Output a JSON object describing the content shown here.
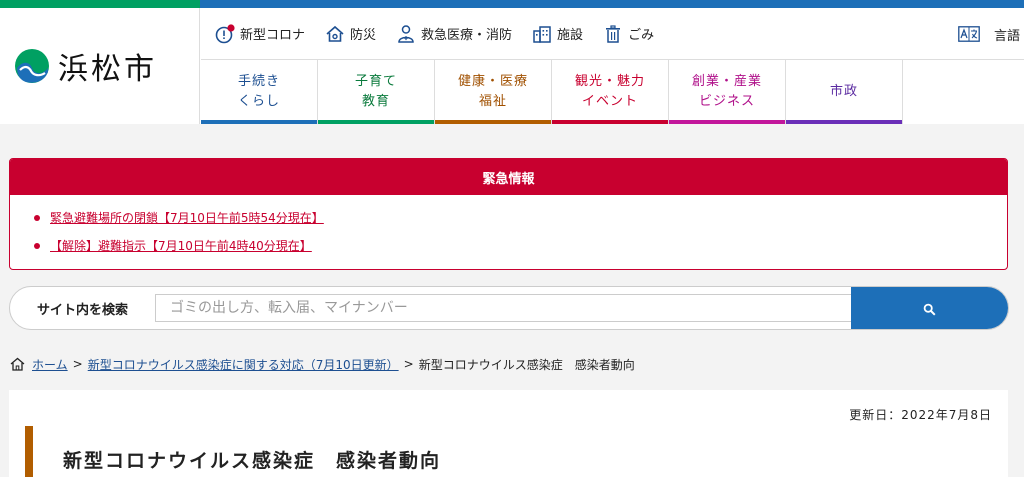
{
  "site": {
    "name": "浜松市",
    "brand_green": "#00a062",
    "brand_blue": "#1d6fb8",
    "logo": "hamamatsu-logo"
  },
  "utility_nav": [
    {
      "label": "新型コロナ",
      "icon": "alert-badge-icon"
    },
    {
      "label": "防災",
      "icon": "house-icon"
    },
    {
      "label": "救急医療・消防",
      "icon": "first-aid-person-icon"
    },
    {
      "label": "施設",
      "icon": "building-icon"
    },
    {
      "label": "ごみ",
      "icon": "trash-icon"
    }
  ],
  "language": {
    "label": "言語",
    "icon": "translate-icon"
  },
  "main_nav": [
    {
      "label": "手続き\nくらし",
      "color": "#1d6fb8",
      "text_color": "#1d4f91"
    },
    {
      "label": "子育て\n教育",
      "color": "#00a062",
      "text_color": "#0a7a3c"
    },
    {
      "label": "健康・医療\n福祉",
      "color": "#b15d00",
      "text_color": "#a05000"
    },
    {
      "label": "観光・魅力\nイベント",
      "color": "#c8002f",
      "text_color": "#c8002f"
    },
    {
      "label": "創業・産業\nビジネス",
      "color": "#c2179b",
      "text_color": "#b0108a"
    },
    {
      "label": "市政",
      "color": "#6a2fb8",
      "text_color": "#5a2aa0"
    }
  ],
  "emergency": {
    "title": "緊急情報",
    "items": [
      "緊急避難場所の閉鎖【7月10日午前5時54分現在】",
      "【解除】避難指示【7月10日午前4時40分現在】"
    ],
    "color": "#c8002f"
  },
  "search": {
    "label": "サイト内を検索",
    "placeholder": "ゴミの出し方、転入届、マイナンバー",
    "value": "",
    "button_icon": "search-icon"
  },
  "breadcrumb": {
    "home": "ホーム",
    "parent": "新型コロナウイルス感染症に関する対応（7月10日更新）",
    "current": "新型コロナウイルス感染症　感染者動向",
    "separator": ">"
  },
  "page": {
    "updated": "更新日：2022年7月8日",
    "title": "新型コロナウイルス感染症　感染者動向",
    "accent": "#b15d00"
  }
}
